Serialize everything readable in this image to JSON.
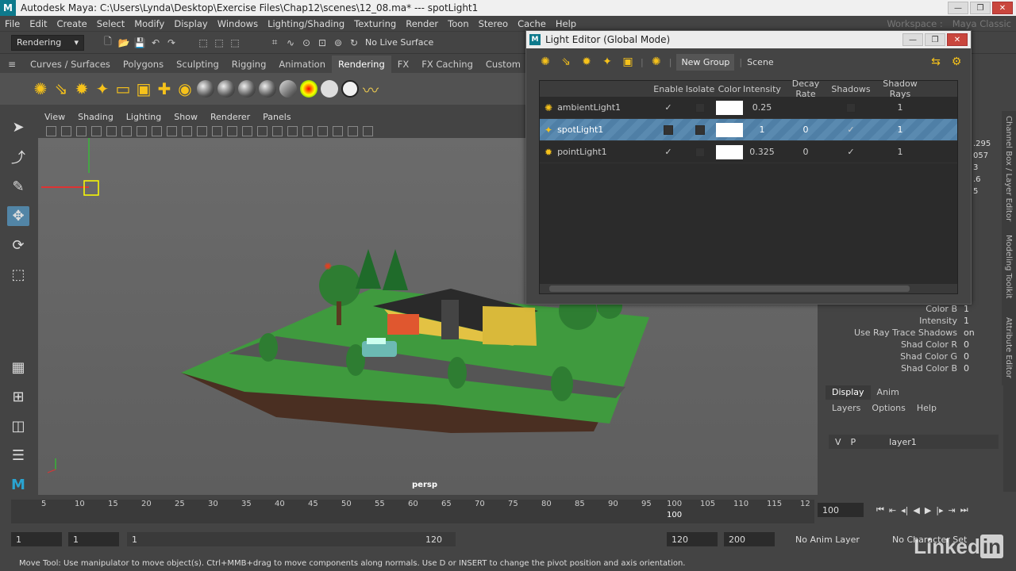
{
  "window": {
    "title": "Autodesk Maya: C:\\Users\\Lynda\\Desktop\\Exercise Files\\Chap12\\scenes\\12_08.ma*  ---  spotLight1",
    "logo_letter": "M"
  },
  "menubar": [
    "File",
    "Edit",
    "Create",
    "Select",
    "Modify",
    "Display",
    "Windows",
    "Lighting/Shading",
    "Texturing",
    "Render",
    "Toon",
    "Stereo",
    "Cache",
    "Help"
  ],
  "statusline": {
    "mode_selector": "Rendering",
    "live_surface": "No Live Surface",
    "workspace": "Workspace :",
    "workspace_value": "Maya Classic"
  },
  "shelf": {
    "tabs": [
      "Curves / Surfaces",
      "Polygons",
      "Sculpting",
      "Rigging",
      "Animation",
      "Rendering",
      "FX",
      "FX Caching",
      "Custom"
    ],
    "active_tab": "Rendering"
  },
  "panel": {
    "menu": [
      "View",
      "Shading",
      "Lighting",
      "Show",
      "Renderer",
      "Panels"
    ],
    "camera_label": "persp"
  },
  "light_editor": {
    "title": "Light Editor (Global Mode)",
    "new_group_label": "New Group",
    "scene_label": "Scene",
    "columns": [
      "Enable",
      "Isolate",
      "Color",
      "Intensity",
      "Decay Rate",
      "Shadows",
      "Shadow Rays"
    ],
    "lights": [
      {
        "name": "ambientLight1",
        "enable": true,
        "isolate": false,
        "color": "#ffffff",
        "intensity": "0.25",
        "decay": "",
        "shadows": false,
        "shadow_rays": "1"
      },
      {
        "name": "spotLight1",
        "enable": false,
        "isolate": false,
        "color": "#ffffff",
        "intensity": "1",
        "decay": "0",
        "shadows": true,
        "shadow_rays": "1"
      },
      {
        "name": "pointLight1",
        "enable": true,
        "isolate": false,
        "color": "#ffffff",
        "intensity": "0.325",
        "decay": "0",
        "shadows": true,
        "shadow_rays": "1"
      }
    ],
    "selected_row": "spotLight1"
  },
  "channel_box": {
    "partial_values": [
      ".295",
      "057",
      "3",
      ".6",
      "5"
    ],
    "attributes": [
      {
        "label": "Color B",
        "value": "1"
      },
      {
        "label": "Intensity",
        "value": "1"
      },
      {
        "label": "Use Ray Trace Shadows",
        "value": "on"
      },
      {
        "label": "Shad Color R",
        "value": "0"
      },
      {
        "label": "Shad Color G",
        "value": "0"
      },
      {
        "label": "Shad Color B",
        "value": "0"
      }
    ],
    "side_tabs": [
      "Channel Box / Layer Editor",
      "Modeling Toolkit",
      "Attribute Editor"
    ]
  },
  "layers": {
    "tabs": [
      "Display",
      "Anim"
    ],
    "active_tab": "Display",
    "menu": [
      "Layers",
      "Options",
      "Help"
    ],
    "layer": {
      "v": "V",
      "p": "P",
      "name": "layer1"
    }
  },
  "timeline": {
    "ticks": [
      "5",
      "10",
      "15",
      "20",
      "25",
      "30",
      "35",
      "40",
      "45",
      "50",
      "55",
      "60",
      "65",
      "70",
      "75",
      "80",
      "85",
      "90",
      "95",
      "100",
      "105",
      "110",
      "115",
      "12"
    ],
    "current_frame_marker": "100",
    "current_frame": "100"
  },
  "range": {
    "start": "1",
    "playback_start": "1",
    "slider_start": "1",
    "slider_end": "120",
    "playback_end": "120",
    "end": "200",
    "anim_layer": "No Anim Layer",
    "character_set": "No Character Set"
  },
  "helpline": "Move Tool: Use manipulator to move object(s). Ctrl+MMB+drag to move components along normals. Use D or INSERT to change the pivot position and axis orientation.",
  "watermark": "Linked"
}
